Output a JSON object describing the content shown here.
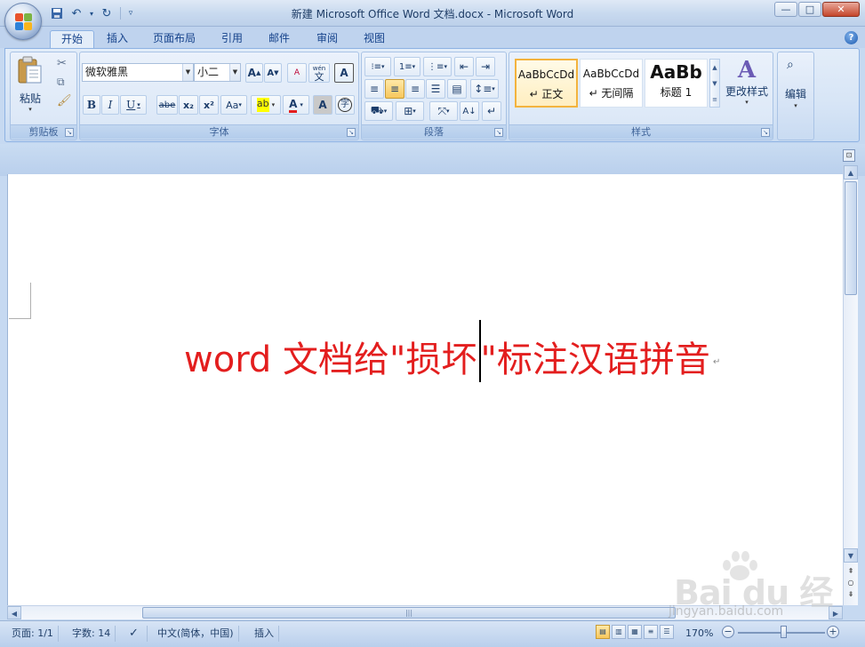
{
  "window": {
    "title": "新建 Microsoft Office Word 文档.docx - Microsoft Word",
    "controls": {
      "minimize": "—",
      "maximize": "□",
      "close": "✕"
    }
  },
  "qat": {
    "save_icon": "save-icon",
    "undo_icon": "undo-icon",
    "redo_icon": "redo-icon"
  },
  "tabs": [
    "开始",
    "插入",
    "页面布局",
    "引用",
    "邮件",
    "审阅",
    "视图"
  ],
  "help": "?",
  "ribbon": {
    "clipboard": {
      "paste": "粘贴",
      "label": "剪贴板"
    },
    "font": {
      "font_name": "微软雅黑",
      "font_size": "小二",
      "grow": "A",
      "shrink": "A",
      "clear": "A",
      "phonetic": "wén",
      "phonetic_char": "文",
      "border_char": "A",
      "bold": "B",
      "italic": "I",
      "underline": "U",
      "strike": "abe",
      "subscript": "x₂",
      "superscript": "x²",
      "case": "Aa",
      "highlight": "ab",
      "color": "A",
      "shade": "A",
      "enclose": "字",
      "label": "字体"
    },
    "paragraph": {
      "label": "段落"
    },
    "styles": {
      "tiles": [
        {
          "sample": "AaBbCcDd",
          "name": "↵ 正文"
        },
        {
          "sample": "AaBbCcDd",
          "name": "↵ 无间隔"
        },
        {
          "sample": "AaBb",
          "name": "标题 1"
        }
      ],
      "change": "更改样式",
      "label": "样式"
    },
    "editing": {
      "label": "编辑"
    }
  },
  "document": {
    "text_before": "word 文档给\"损坏",
    "text_after": "\"标注汉语拼音",
    "para_mark": "↵",
    "text_color": "#e31e1e"
  },
  "status": {
    "page": "页面: 1/1",
    "words": "字数: 14",
    "language": "中文(简体，中国)",
    "mode": "插入",
    "zoom": "170%"
  },
  "watermark": {
    "logo": "Bai  du 经验",
    "url": "jingyan.baidu.com"
  }
}
